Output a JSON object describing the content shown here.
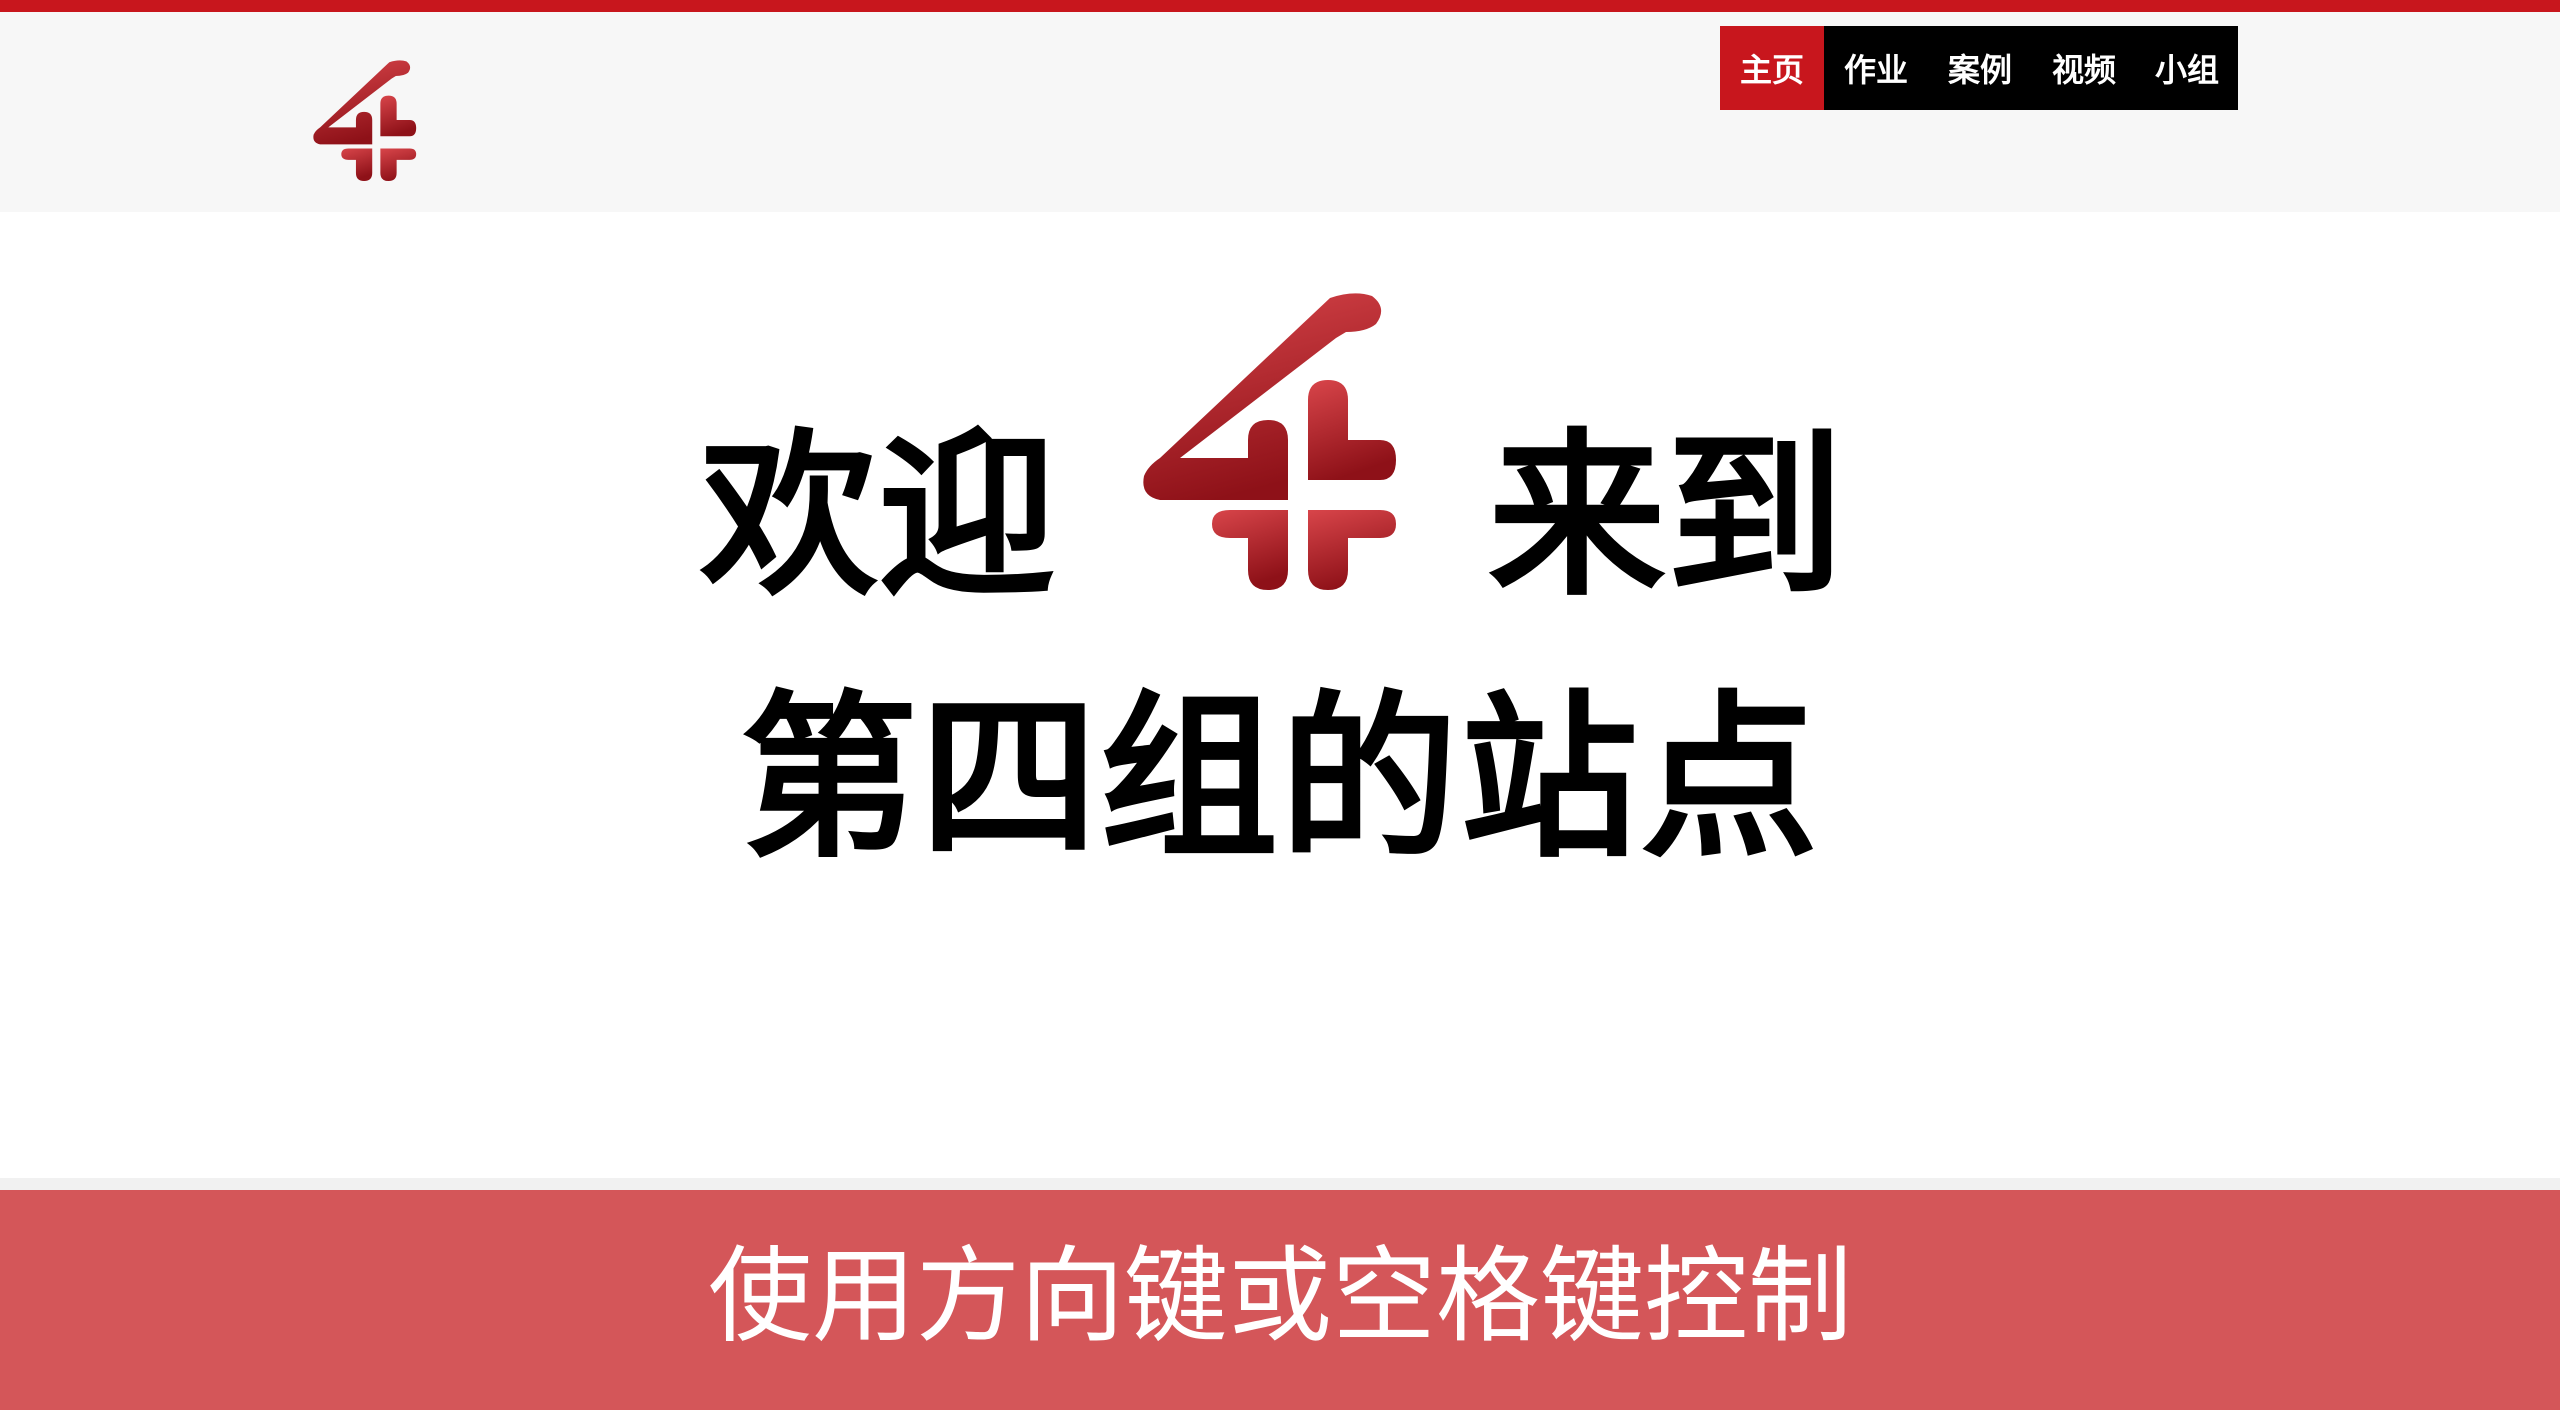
{
  "header": {
    "logo_icon": "four-logo-icon"
  },
  "nav": {
    "items": [
      {
        "label": "主页",
        "active": true
      },
      {
        "label": "作业",
        "active": false
      },
      {
        "label": "案例",
        "active": false
      },
      {
        "label": "视频",
        "active": false
      },
      {
        "label": "小组",
        "active": false
      }
    ]
  },
  "hero": {
    "line1_left": "欢迎",
    "line1_right": "来到",
    "line2": "第四组的站点",
    "logo_icon": "four-logo-icon"
  },
  "footer": {
    "hint": "使用方向键或空格键控制"
  },
  "colors": {
    "accent": "#c8161d",
    "footer_bg": "#d45659",
    "nav_bg": "#000000",
    "header_bg": "#f7f7f7"
  }
}
